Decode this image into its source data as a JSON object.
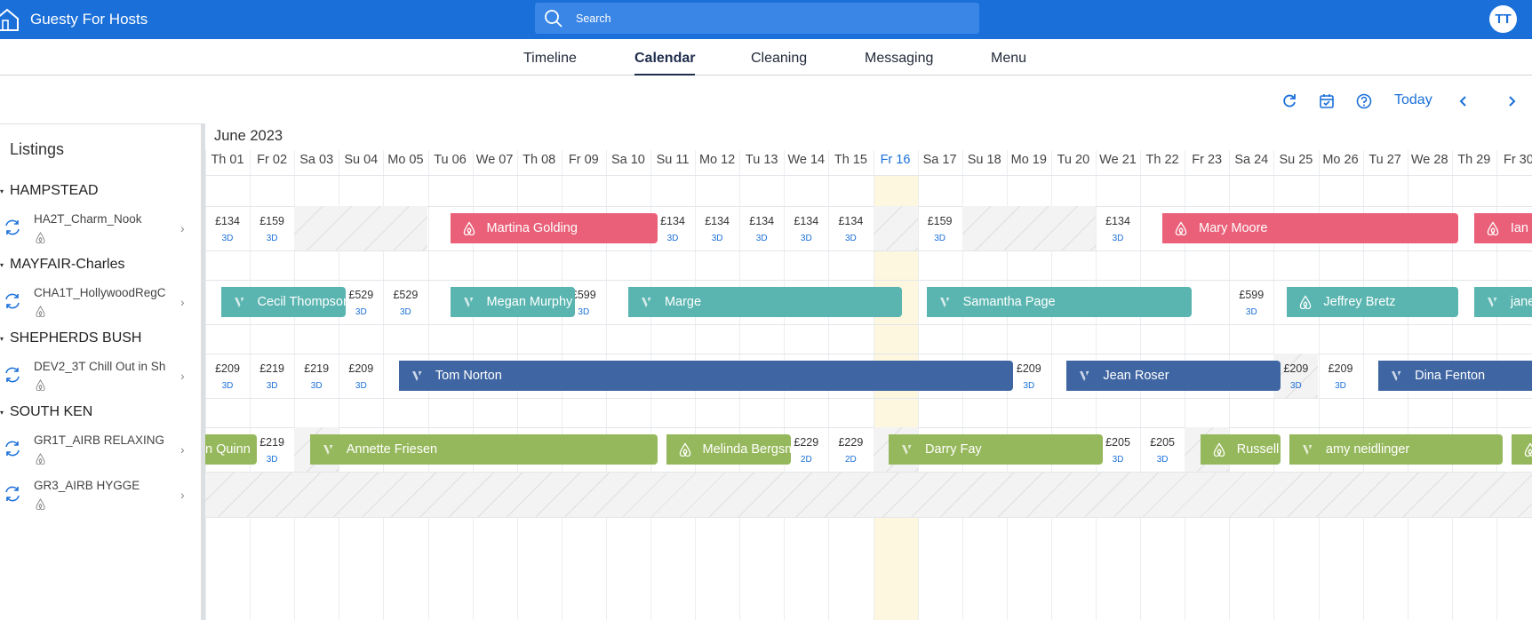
{
  "app": {
    "title": "Guesty For Hosts",
    "user_initials": "TT"
  },
  "search": {
    "placeholder": "Search"
  },
  "nav": {
    "tabs": [
      "Timeline",
      "Calendar",
      "Cleaning",
      "Messaging",
      "Menu"
    ],
    "active": "Calendar"
  },
  "toolbar": {
    "today_label": "Today",
    "icons": [
      "refresh-icon",
      "calendar-check-icon",
      "help-icon",
      "chevron-left-icon",
      "chevron-right-icon"
    ]
  },
  "listings": {
    "title": "Listings",
    "groups": [
      {
        "name": "HAMPSTEAD",
        "items": [
          {
            "name": "HA2T_Charm_Nook"
          }
        ]
      },
      {
        "name": "MAYFAIR-Charles",
        "items": [
          {
            "name": "CHA1T_HollywoodRegC"
          }
        ]
      },
      {
        "name": "SHEPHERDS BUSH",
        "items": [
          {
            "name": "DEV2_3T Chill Out in Sh"
          }
        ]
      },
      {
        "name": "SOUTH KEN",
        "items": [
          {
            "name": "GR1T_AIRB RELAXING"
          },
          {
            "name": "GR3_AIRB HYGGE"
          }
        ]
      }
    ]
  },
  "calendar": {
    "month": "June 2023",
    "days": [
      "Th 01",
      "Fr 02",
      "Sa 03",
      "Su 04",
      "Mo 05",
      "Tu 06",
      "We 07",
      "Th 08",
      "Fr 09",
      "Sa 10",
      "Su 11",
      "Mo 12",
      "Tu 13",
      "We 14",
      "Th 15",
      "Fr 16",
      "Sa 17",
      "Su 18",
      "Mo 19",
      "Tu 20",
      "We 21",
      "Th 22",
      "Fr 23",
      "Sa 24",
      "Su 25",
      "Mo 26",
      "Tu 27",
      "We 28",
      "Th 29",
      "Fr 30"
    ],
    "today_index": 15,
    "rows": [
      {
        "unavailable": [
          [
            2,
            5
          ],
          [
            15,
            16
          ],
          [
            17,
            20
          ]
        ],
        "prices": [
          {
            "day": 0,
            "price": "£134",
            "min": "3D"
          },
          {
            "day": 1,
            "price": "£159",
            "min": "3D"
          },
          {
            "day": 10,
            "price": "£134",
            "min": "3D"
          },
          {
            "day": 11,
            "price": "£134",
            "min": "3D"
          },
          {
            "day": 12,
            "price": "£134",
            "min": "3D"
          },
          {
            "day": 13,
            "price": "£134",
            "min": "3D"
          },
          {
            "day": 14,
            "price": "£134",
            "min": "3D"
          },
          {
            "day": 16,
            "price": "£159",
            "min": "3D"
          },
          {
            "day": 20,
            "price": "£134",
            "min": "3D"
          }
        ],
        "reservations": [
          {
            "guest": "Martina Golding",
            "start": 5.5,
            "end": 10.15,
            "channel": "airbnb",
            "color": "#ea6079"
          },
          {
            "guest": "Mary Moore",
            "start": 21.5,
            "end": 28.15,
            "channel": "airbnb",
            "color": "#ea6079"
          },
          {
            "guest": "Ian Scr",
            "start": 28.5,
            "end": 31,
            "channel": "airbnb",
            "color": "#ea6079"
          }
        ]
      },
      {
        "unavailable": [],
        "prices": [
          {
            "day": 3,
            "price": "£529",
            "min": "3D"
          },
          {
            "day": 4,
            "price": "£529",
            "min": "3D"
          },
          {
            "day": 8,
            "price": "£599",
            "min": "3D"
          },
          {
            "day": 23,
            "price": "£599",
            "min": "3D"
          }
        ],
        "reservations": [
          {
            "guest": "Cecil Thompson",
            "start": 0.35,
            "end": 3.15,
            "channel": "vrbo",
            "color": "#5ab5b0"
          },
          {
            "guest": "Megan Murphy",
            "start": 5.5,
            "end": 8.3,
            "channel": "vrbo",
            "color": "#5ab5b0"
          },
          {
            "guest": "Marge",
            "start": 9.5,
            "end": 15.65,
            "channel": "vrbo",
            "color": "#5ab5b0"
          },
          {
            "guest": "Samantha Page",
            "start": 16.2,
            "end": 22.15,
            "channel": "vrbo",
            "color": "#5ab5b0"
          },
          {
            "guest": "Jeffrey Bretz",
            "start": 24.3,
            "end": 28.15,
            "channel": "airbnb",
            "color": "#5ab5b0"
          },
          {
            "guest": "jane by",
            "start": 28.5,
            "end": 31,
            "channel": "vrbo",
            "color": "#5ab5b0"
          }
        ]
      },
      {
        "unavailable": [
          [
            24,
            25
          ]
        ],
        "prices": [
          {
            "day": 0,
            "price": "£209",
            "min": "3D"
          },
          {
            "day": 1,
            "price": "£219",
            "min": "3D"
          },
          {
            "day": 2,
            "price": "£219",
            "min": "3D"
          },
          {
            "day": 3,
            "price": "£209",
            "min": "3D"
          },
          {
            "day": 18,
            "price": "£209",
            "min": "3D"
          },
          {
            "day": 24,
            "price": "£209",
            "min": "3D"
          },
          {
            "day": 25,
            "price": "£209",
            "min": "3D"
          }
        ],
        "reservations": [
          {
            "guest": "Tom Norton",
            "start": 4.35,
            "end": 18.15,
            "channel": "vrbo",
            "color": "#3f66a2"
          },
          {
            "guest": "Jean Roser",
            "start": 19.35,
            "end": 24.15,
            "channel": "vrbo",
            "color": "#3f66a2"
          },
          {
            "guest": "Dina Fenton",
            "start": 26.35,
            "end": 31,
            "channel": "vrbo",
            "color": "#3f66a2"
          }
        ]
      },
      {
        "unavailable": [
          [
            2,
            3
          ],
          [
            15,
            16
          ],
          [
            22,
            23
          ]
        ],
        "prices": [
          {
            "day": 1,
            "price": "£219",
            "min": "3D"
          },
          {
            "day": 13,
            "price": "£229",
            "min": "2D"
          },
          {
            "day": 14,
            "price": "£229",
            "min": "2D"
          },
          {
            "day": 20,
            "price": "£205",
            "min": "3D"
          },
          {
            "day": 21,
            "price": "£205",
            "min": "3D"
          }
        ],
        "reservations": [
          {
            "guest": "n Quinn",
            "start": 0,
            "end": 1.15,
            "channel": "none",
            "color": "#96b85c"
          },
          {
            "guest": "Annette Friesen",
            "start": 2.35,
            "end": 10.15,
            "channel": "vrbo",
            "color": "#96b85c"
          },
          {
            "guest": "Melinda Bergsma",
            "start": 10.35,
            "end": 13.15,
            "channel": "airbnb",
            "color": "#96b85c"
          },
          {
            "guest": "Darry Fay",
            "start": 15.35,
            "end": 20.15,
            "channel": "vrbo",
            "color": "#96b85c"
          },
          {
            "guest": "Russell G",
            "start": 22.35,
            "end": 24.15,
            "channel": "airbnb",
            "color": "#96b85c"
          },
          {
            "guest": "amy neidlinger",
            "start": 24.35,
            "end": 29.15,
            "channel": "vrbo",
            "color": "#96b85c"
          },
          {
            "guest": "",
            "start": 29.35,
            "end": 31,
            "channel": "airbnb",
            "color": "#96b85c"
          }
        ]
      },
      {
        "unavailable": [
          [
            0,
            31
          ]
        ],
        "prices": [],
        "reservations": []
      }
    ]
  }
}
